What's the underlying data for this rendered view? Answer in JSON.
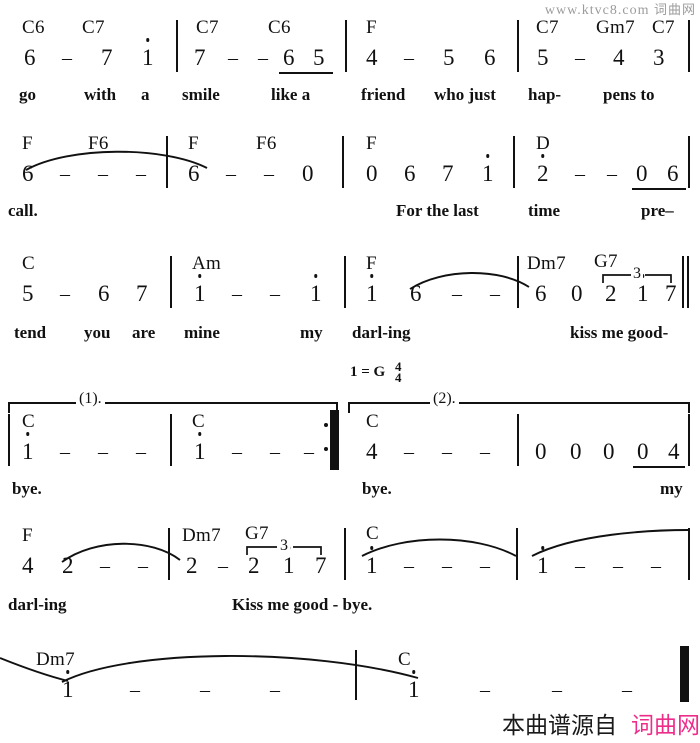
{
  "watermark": {
    "url": "www.ktvc8.com",
    "site_cn": "词曲网"
  },
  "footer": {
    "prefix": "本曲谱源自",
    "site": "词曲网",
    "accent_color": "#ee2d8a"
  },
  "key_signature": {
    "text": "1 = G",
    "meter_top": "4",
    "meter_bottom": "4"
  },
  "systems": [
    {
      "id": "system-1",
      "chords": [
        "C6",
        "C7",
        "C7",
        "C6",
        "F",
        "C7",
        "Gm7",
        "C7"
      ],
      "notes": [
        "6",
        "–",
        "7",
        "1",
        "7",
        "–",
        "–",
        "6",
        "5",
        "4",
        "–",
        "5",
        "6",
        "5",
        "–",
        "4",
        "3"
      ],
      "lyrics": [
        "go",
        "with",
        "a",
        "smile",
        "like a",
        "friend",
        "who just",
        "hap-",
        "pens to"
      ]
    },
    {
      "id": "system-2",
      "chords": [
        "F",
        "F6",
        "F",
        "F6",
        "F",
        "D"
      ],
      "notes": [
        "6",
        "–",
        "–",
        "–",
        "6",
        "–",
        "–",
        "0",
        "0",
        "6",
        "7",
        "1",
        "2",
        "–",
        "–",
        "0",
        "6"
      ],
      "lyrics": [
        "call.",
        "For the last",
        "time",
        "pre–"
      ]
    },
    {
      "id": "system-3",
      "chords": [
        "C",
        "Am",
        "F",
        "Dm7",
        "G7"
      ],
      "notes": [
        "5",
        "–",
        "6",
        "7",
        "1",
        "–",
        "–",
        "1",
        "1",
        "6",
        "–",
        "–",
        "6",
        "0",
        "2",
        "1",
        "7"
      ],
      "lyrics": [
        "tend",
        "you",
        "are",
        "mine",
        "my",
        "darl-ing",
        "kiss me good-"
      ],
      "triplet": "3"
    },
    {
      "id": "system-4",
      "chords": [
        "C",
        "C",
        "C"
      ],
      "notes": [
        "1",
        "–",
        "–",
        "–",
        "1",
        "–",
        "–",
        "–",
        "4",
        "–",
        "–",
        "–",
        "0",
        "0",
        "0",
        "0",
        "4"
      ],
      "lyrics": [
        "bye.",
        "bye.",
        "my"
      ],
      "endings": [
        "(1).",
        "(2)."
      ]
    },
    {
      "id": "system-5",
      "chords": [
        "F",
        "Dm7",
        "G7",
        "C"
      ],
      "notes": [
        "4",
        "2",
        "–",
        "–",
        "2",
        "–",
        "2",
        "1",
        "7",
        "1",
        "–",
        "–",
        "–",
        "1",
        "–",
        "–",
        "–"
      ],
      "lyrics": [
        "darl-ing",
        "Kiss me good - bye."
      ],
      "triplet": "3"
    },
    {
      "id": "system-6",
      "chords": [
        "Dm7",
        "C"
      ],
      "notes": [
        "1",
        "–",
        "–",
        "–",
        "1",
        "–",
        "–",
        "–"
      ],
      "lyrics": []
    }
  ]
}
